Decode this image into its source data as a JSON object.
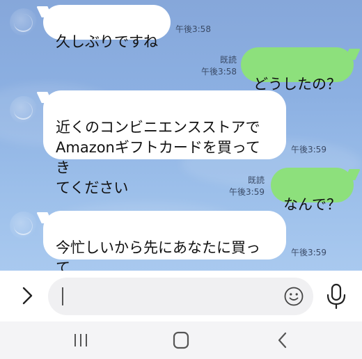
{
  "messages": [
    {
      "direction": "in",
      "text": "久しぶりですね",
      "time": "午後3:58"
    },
    {
      "direction": "out",
      "text": "どうしたの？",
      "read": "既読",
      "time": "午後3:58"
    },
    {
      "direction": "in",
      "text": "近くのコンビニエンスストアで\nAmazonギフトカードを買ってき\nてください",
      "time": "午後3:59"
    },
    {
      "direction": "out",
      "text": "なんで？",
      "read": "既読",
      "time": "午後3:59"
    },
    {
      "direction": "in",
      "text": "今忙しいから先にあなたに買って\nきてもらってもいいですか",
      "time": "午後3:59"
    }
  ],
  "input": {
    "value": "",
    "placeholder": ""
  },
  "icons": {
    "expand": "chevron-right-icon",
    "emoji": "smiley-icon",
    "mic": "microphone-icon",
    "nav_recents": "recents-icon",
    "nav_home": "home-icon",
    "nav_back": "back-icon"
  },
  "colors": {
    "chat_background": "#8cb0e2",
    "incoming_bubble": "#ffffff",
    "outgoing_bubble": "#8de07c"
  }
}
